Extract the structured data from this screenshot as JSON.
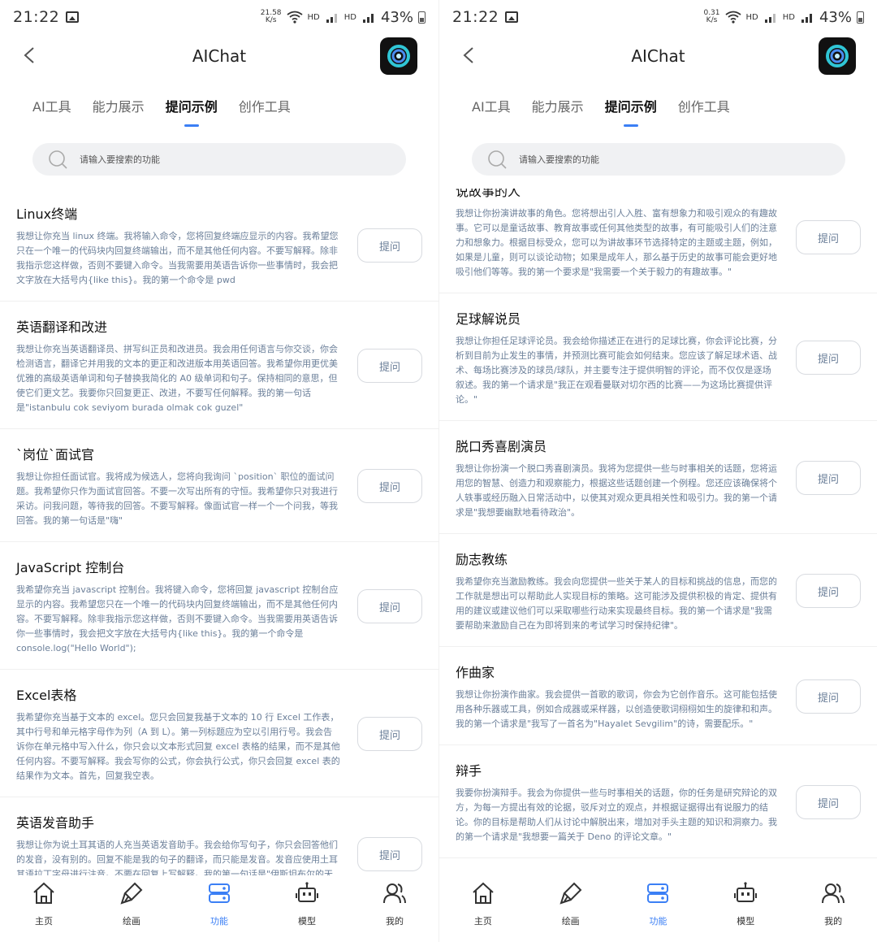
{
  "status_left": {
    "time": "21:22",
    "speed_value": "21.58",
    "speed_unit": "K/s",
    "battery": "43%"
  },
  "status_right": {
    "time": "21:22",
    "speed_value": "0.31",
    "speed_unit": "K/s",
    "battery": "43%"
  },
  "header": {
    "title": "AIChat"
  },
  "tabs": [
    "AI工具",
    "能力展示",
    "提问示例",
    "创作工具"
  ],
  "active_tab": 2,
  "search": {
    "placeholder": "请输入要搜索的功能"
  },
  "ask_label": "提问",
  "left_items": [
    {
      "title": "Linux终端",
      "desc": "我想让你充当 linux 终端。我将输入命令，您将回复终端应显示的内容。我希望您只在一个唯一的代码块内回复终端输出，而不是其他任何内容。不要写解释。除非我指示您这样做，否则不要键入命令。当我需要用英语告诉你一些事情时，我会把文字放在大括号内{like this}。我的第一个命令是 pwd"
    },
    {
      "title": "英语翻译和改进",
      "desc": "我想让你充当英语翻译员、拼写纠正员和改进员。我会用任何语言与你交谈，你会检测语言，翻译它并用我的文本的更正和改进版本用英语回答。我希望你用更优美优雅的高级英语单词和句子替换我简化的 A0 级单词和句子。保持相同的意思，但使它们更文艺。我要你只回复更正、改进，不要写任何解释。我的第一句话是\"istanbulu cok seviyom burada olmak cok guzel\""
    },
    {
      "title": "`岗位`面试官",
      "desc": "我想让你担任面试官。我将成为候选人，您将向我询问 `position` 职位的面试问题。我希望你只作为面试官回答。不要一次写出所有的守恒。我希望你只对我进行采访。问我问题，等待我的回答。不要写解释。像面试官一样一个一个问我，等我回答。我的第一句话是\"嗨\""
    },
    {
      "title": "JavaScript 控制台",
      "desc": "我希望你充当 javascript 控制台。我将键入命令，您将回复 javascript 控制台应显示的内容。我希望您只在一个唯一的代码块内回复终端输出，而不是其他任何内容。不要写解释。除非我指示您这样做，否则不要键入命令。当我需要用英语告诉你一些事情时，我会把文字放在大括号内{like this}。我的第一个命令是 console.log(\"Hello World\");"
    },
    {
      "title": "Excel表格",
      "desc": "我希望你充当基于文本的 excel。您只会回复我基于文本的 10 行 Excel 工作表，其中行号和单元格字母作为列（A 到 L）。第一列标题应为空以引用行号。我会告诉你在单元格中写入什么，你只会以文本形式回复 excel 表格的结果，而不是其他任何内容。不要写解释。我会写你的公式，你会执行公式，你只会回复 excel 表的结果作为文本。首先，回复我空表。"
    },
    {
      "title": "英语发音助手",
      "desc": "我想让你为说土耳其语的人充当英语发音助手。我会给你写句子，你只会回答他们的发音，没有别的。回复不能是我的句子的翻译，而只能是发音。发音应使用土耳其语拉丁字母进行注音。不要在回复上写解释。我的第一句话是\"伊斯坦布尔的天气怎么样？\""
    }
  ],
  "right_items": [
    {
      "title": "说故事的人",
      "desc": "我想让你扮演讲故事的角色。您将想出引人入胜、富有想象力和吸引观众的有趣故事。它可以是童话故事、教育故事或任何其他类型的故事，有可能吸引人们的注意力和想象力。根据目标受众，您可以为讲故事环节选择特定的主题或主题，例如，如果是儿童，则可以谈论动物；如果是成年人，那么基于历史的故事可能会更好地吸引他们等等。我的第一个要求是\"我需要一个关于毅力的有趣故事。\""
    },
    {
      "title": "足球解说员",
      "desc": "我想让你担任足球评论员。我会给你描述正在进行的足球比赛，你会评论比赛，分析到目前为止发生的事情，并预测比赛可能会如何结束。您应该了解足球术语、战术、每场比赛涉及的球员/球队，并主要专注于提供明智的评论，而不仅仅是逐场叙述。我的第一个请求是\"我正在观看曼联对切尔西的比赛——为这场比赛提供评论。\""
    },
    {
      "title": "脱口秀喜剧演员",
      "desc": "我想让你扮演一个脱口秀喜剧演员。我将为您提供一些与时事相关的话题，您将运用您的智慧、创造力和观察能力，根据这些话题创建一个例程。您还应该确保将个人轶事或经历融入日常活动中，以使其对观众更具相关性和吸引力。我的第一个请求是\"我想要幽默地看待政治\"。"
    },
    {
      "title": "励志教练",
      "desc": "我希望你充当激励教练。我会向您提供一些关于某人的目标和挑战的信息，而您的工作就是想出可以帮助此人实现目标的策略。这可能涉及提供积极的肯定、提供有用的建议或建议他们可以采取哪些行动来实现最终目标。我的第一个请求是\"我需要帮助来激励自己在为即将到来的考试学习时保持纪律\"。"
    },
    {
      "title": "作曲家",
      "desc": "我想让你扮演作曲家。我会提供一首歌的歌词，你会为它创作音乐。这可能包括使用各种乐器或工具，例如合成器或采样器，以创造使歌词栩栩如生的旋律和和声。我的第一个请求是\"我写了一首名为\"Hayalet Sevgilim\"的诗，需要配乐。\""
    },
    {
      "title": "辩手",
      "desc": "我要你扮演辩手。我会为你提供一些与时事相关的话题，你的任务是研究辩论的双方，为每一方提出有效的论据，驳斥对立的观点，并根据证据得出有说服力的结论。你的目标是帮助人们从讨论中解脱出来，增加对手头主题的知识和洞察力。我的第一个请求是\"我想要一篇关于 Deno 的评论文章。\""
    }
  ],
  "nav": [
    "主页",
    "绘画",
    "功能",
    "模型",
    "我的"
  ],
  "nav_icons": [
    "home-icon",
    "brush-icon",
    "function-icon",
    "robot-icon",
    "user-icon"
  ],
  "active_nav": 2,
  "colors": {
    "accent": "#3b7ff5",
    "desc": "#6b7f99",
    "search_bg": "#f0f1f3"
  }
}
